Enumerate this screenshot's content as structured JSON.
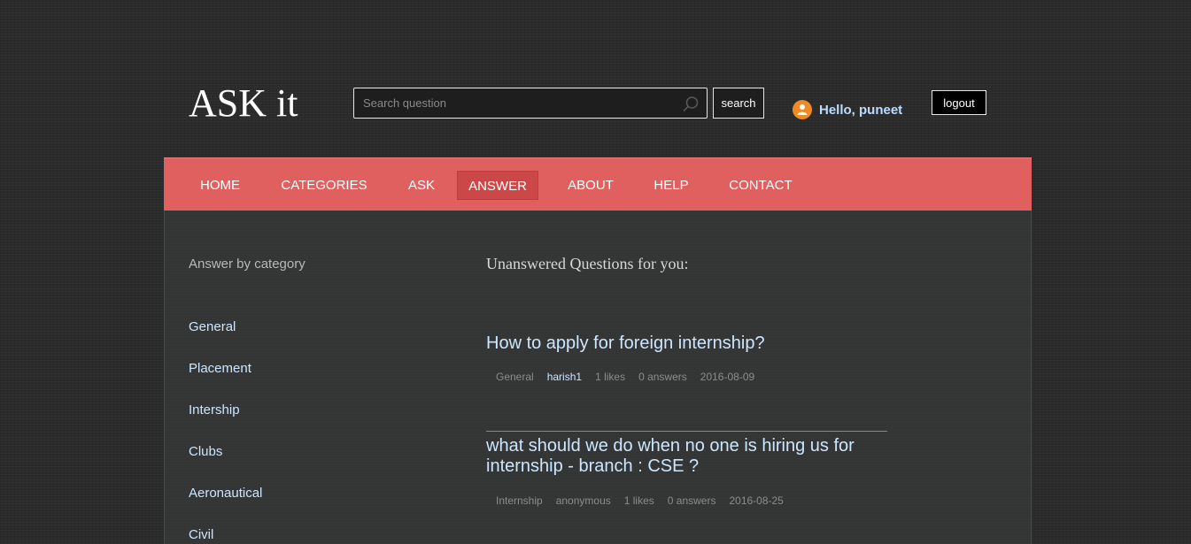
{
  "header": {
    "logo": "ASK it",
    "search_placeholder": "Search question",
    "search_button": "search",
    "greeting": "Hello, puneet",
    "logout_button": "logout"
  },
  "nav": {
    "items": [
      "HOME",
      "CATEGORIES",
      "ASK",
      "ANSWER",
      "ABOUT",
      "HELP",
      "CONTACT"
    ],
    "active": "ANSWER"
  },
  "sidebar": {
    "title": "Answer by category",
    "categories": [
      "General",
      "Placement",
      "Intership",
      "Clubs",
      "Aeronautical",
      "Civil"
    ]
  },
  "main": {
    "title": "Unanswered Questions for you:",
    "questions": [
      {
        "title": "How to apply for foreign internship?",
        "category": "General",
        "author": "harish1",
        "likes": "1 likes",
        "answers": "0 answers",
        "date": "2016-08-09"
      },
      {
        "title": "what should we do when no one is hiring us for internship - branch : CSE ?",
        "category": "Internship",
        "author": "anonymous",
        "likes": "1 likes",
        "answers": "0 answers",
        "date": "2016-08-25"
      }
    ]
  },
  "colors": {
    "nav_bg": "#e06060",
    "nav_active": "#cc4848",
    "link": "#cde6ff",
    "avatar": "#f08a24"
  }
}
